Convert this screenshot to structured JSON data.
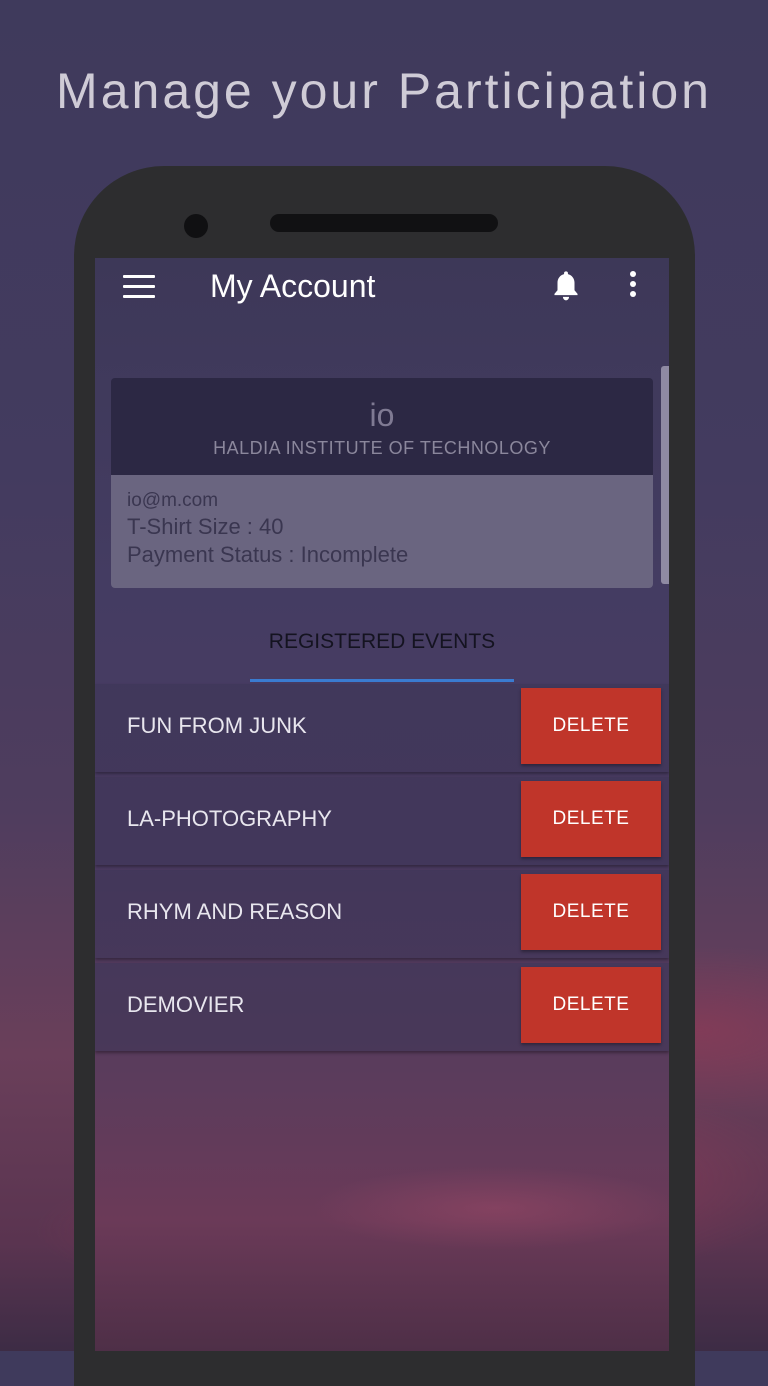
{
  "headline": "Manage your Participation",
  "appbar": {
    "title": "My Account",
    "icons": [
      "menu-icon",
      "bell-icon",
      "more-vert-icon"
    ]
  },
  "profile": {
    "name": "io",
    "institute": "HALDIA INSTITUTE OF TECHNOLOGY",
    "email": "io@m.com",
    "tshirt": "T-Shirt Size : 40",
    "payment": "Payment Status : Incomplete"
  },
  "tab": {
    "label": "REGISTERED EVENTS"
  },
  "events": [
    {
      "name": "FUN FROM JUNK",
      "action": "DELETE"
    },
    {
      "name": "LA-PHOTOGRAPHY",
      "action": "DELETE"
    },
    {
      "name": "RHYM AND REASON",
      "action": "DELETE"
    },
    {
      "name": "DEMOVIER",
      "action": "DELETE"
    }
  ],
  "colors": {
    "delete": "#c0352a",
    "tab_indicator": "#3a7bd0",
    "card_header": "#2c2844",
    "card_body": "#6a6580"
  }
}
